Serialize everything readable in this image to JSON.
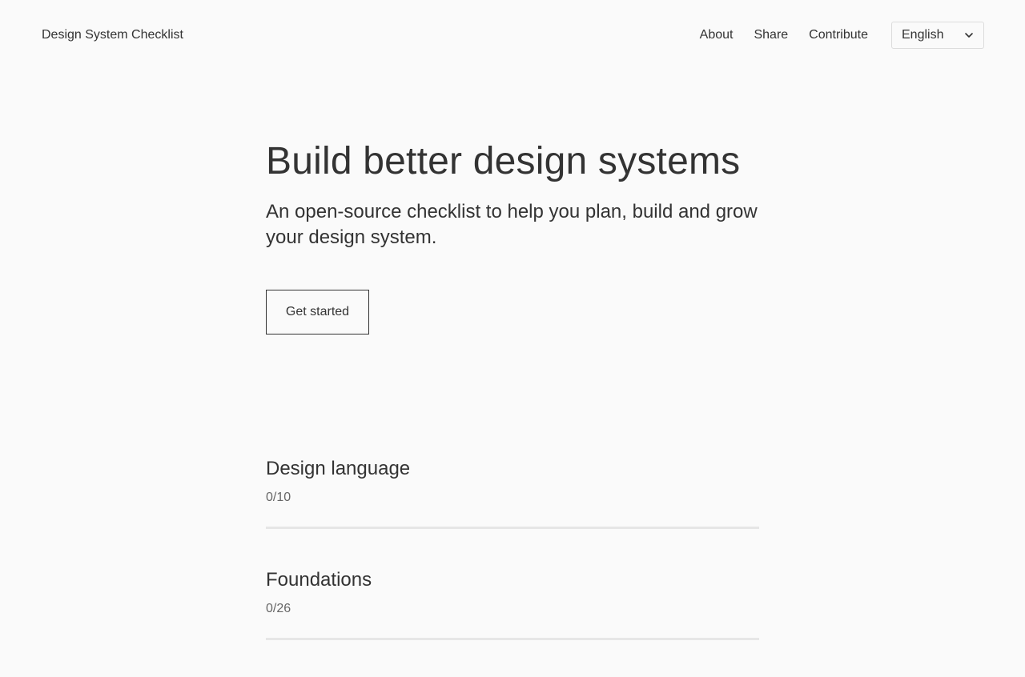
{
  "header": {
    "brand": "Design System Checklist",
    "nav": [
      "About",
      "Share",
      "Contribute"
    ],
    "language": {
      "selected": "English"
    }
  },
  "hero": {
    "title": "Build better design systems",
    "subtitle": "An open-source checklist to help you plan, build and grow your design system.",
    "cta_label": "Get started"
  },
  "sections": [
    {
      "title": "Design language",
      "progress": "0/10"
    },
    {
      "title": "Foundations",
      "progress": "0/26"
    }
  ],
  "icons": {
    "language_dropdown": "chevron-down-icon"
  },
  "colors": {
    "background": "#fafafa",
    "text": "#333333",
    "muted_text": "#666666",
    "divider": "#e6e6e6",
    "select_border": "#dcdcdc"
  }
}
